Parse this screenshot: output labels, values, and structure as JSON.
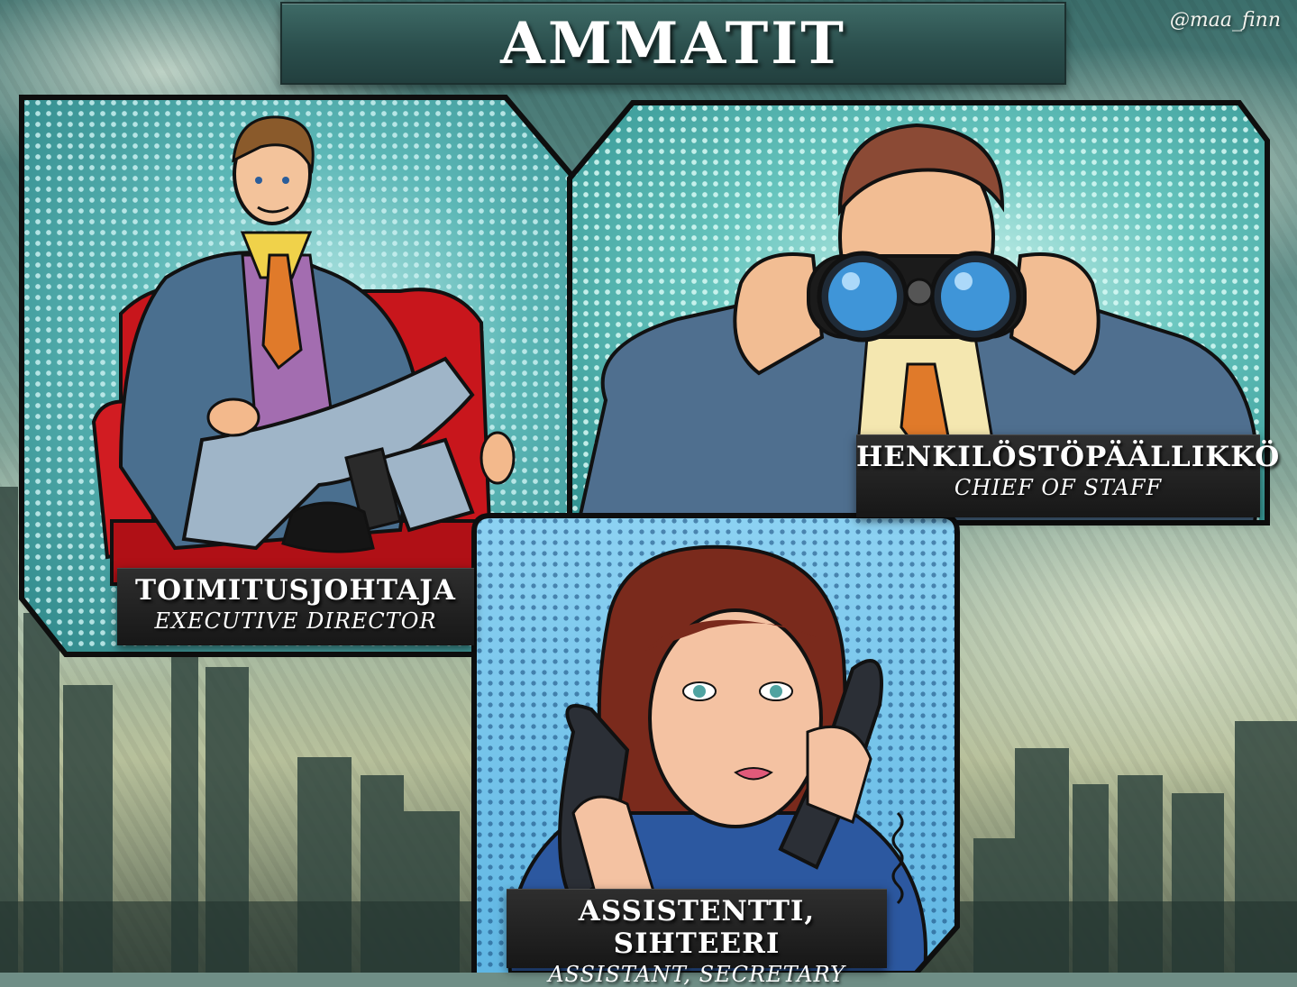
{
  "title": "AMMATIT",
  "credit": "@maa_finn",
  "cards": [
    {
      "fi": "TOIMITUSJOHTAJA",
      "en": "EXECUTIVE DIRECTOR"
    },
    {
      "fi": "HENKILÖSTÖPÄÄLLIKKÖ",
      "en": "CHIEF OF STAFF"
    },
    {
      "fi": "ASSISTENTTI,  SIHTEERI",
      "en": "ASSISTANT,  SECRETARY"
    }
  ],
  "colors": {
    "banner": "#2b4f4d",
    "label_bg": "#1f1f1f",
    "panel_teal": "#2f8f91",
    "panel_blue": "#4aa5d8"
  }
}
